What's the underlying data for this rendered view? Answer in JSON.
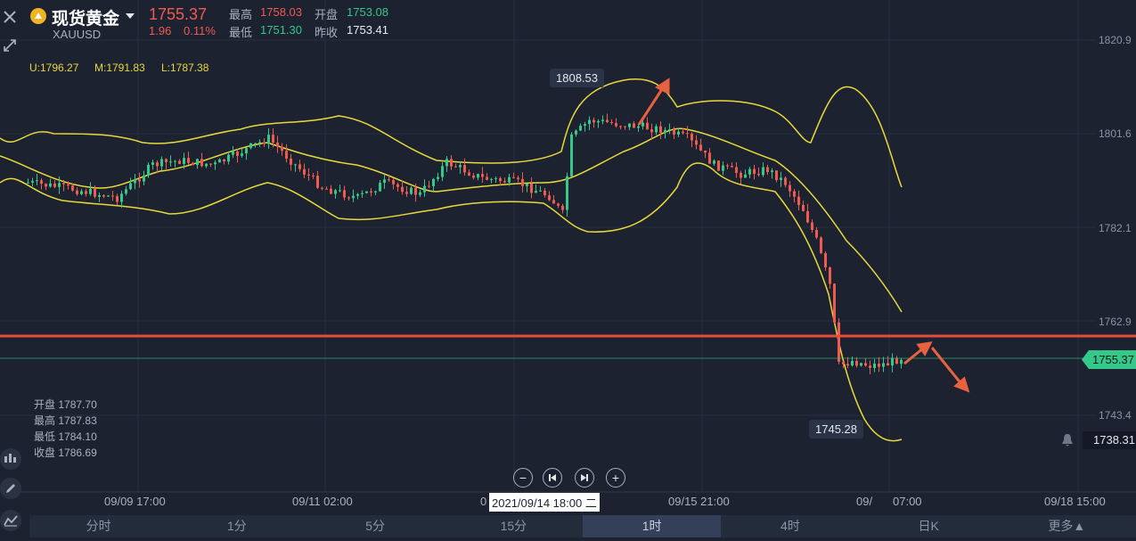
{
  "header": {
    "title": "现货黄金",
    "symbol": "XAUUSD",
    "price": "1755.37",
    "change": "1.96",
    "change_pct": "0.11%",
    "high_label": "最高",
    "high_value": "1758.03",
    "open_label": "开盘",
    "open_value": "1753.08",
    "low_label": "最低",
    "low_value": "1751.30",
    "prev_close_label": "昨收",
    "prev_close_value": "1753.41"
  },
  "indicator": {
    "upper": "U:1796.27",
    "mid": "M:1791.83",
    "lower": "L:1787.38"
  },
  "y_axis": [
    "1820.9",
    "1801.6",
    "1782.1",
    "1762.9",
    "1743.4"
  ],
  "x_axis": [
    "09/09 17:00",
    "09/11 02:00",
    "0",
    "09/15 21:00",
    "09/",
    "07:00",
    "09/18 15:00"
  ],
  "crosshair_date": "2021/09/14 18:00 二",
  "tooltips": {
    "high": "1808.53",
    "low": "1745.28"
  },
  "current_price_badge": "1755.37",
  "alert_price": "1738.31",
  "ohlc": [
    {
      "label": "开盘",
      "value": "1787.70"
    },
    {
      "label": "最高",
      "value": "1787.83"
    },
    {
      "label": "最低",
      "value": "1784.10"
    },
    {
      "label": "收盘",
      "value": "1786.69"
    }
  ],
  "tabs": [
    "分时",
    "1分",
    "5分",
    "15分",
    "1时",
    "4时",
    "日K",
    "更多▲"
  ],
  "active_tab": "1时",
  "colors": {
    "background": "#1c2230",
    "up": "#34c88a",
    "down": "#f05a4f",
    "band": "#e8d93a",
    "resistance": "#e84b3a",
    "arrow": "#e8623f"
  }
}
